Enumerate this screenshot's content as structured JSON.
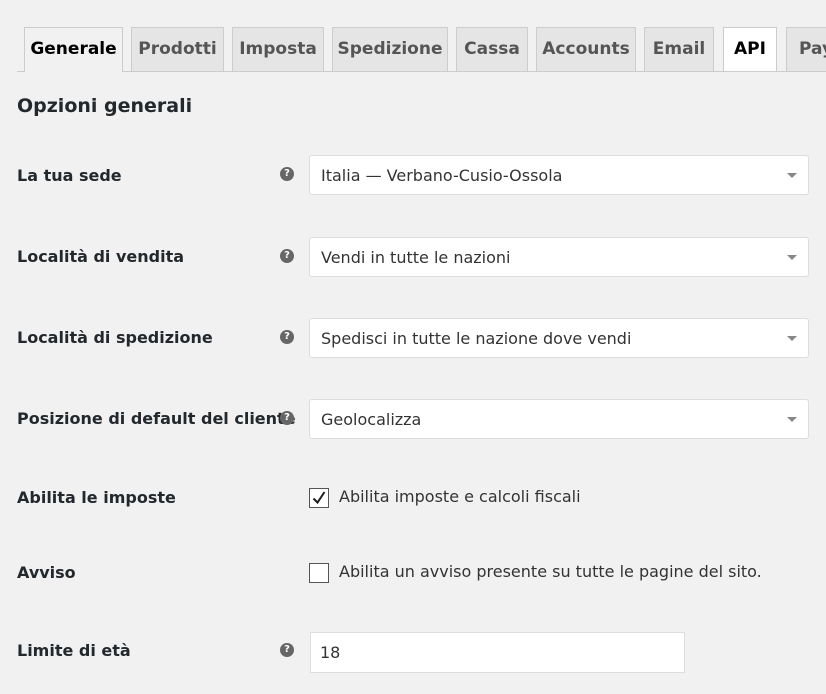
{
  "tabs": [
    {
      "label": "Generale",
      "state": "active"
    },
    {
      "label": "Prodotti",
      "state": "normal"
    },
    {
      "label": "Imposta",
      "state": "normal"
    },
    {
      "label": "Spedizione",
      "state": "normal"
    },
    {
      "label": "Cassa",
      "state": "normal"
    },
    {
      "label": "Accounts",
      "state": "normal"
    },
    {
      "label": "Email",
      "state": "normal"
    },
    {
      "label": "API",
      "state": "highlight"
    },
    {
      "label": "Pay",
      "state": "normal"
    }
  ],
  "section_title": "Opzioni generali",
  "help_icon": {
    "glyph": "?",
    "icon": "help-icon"
  },
  "fields": {
    "store_location": {
      "label": "La tua sede",
      "value": "Italia — Verbano-Cusio-Ossola"
    },
    "selling_location": {
      "label": "Località di vendita",
      "value": "Vendi in tutte le nazioni"
    },
    "shipping_location": {
      "label": "Località di spedizione",
      "value": "Spedisci in tutte le nazione dove vendi"
    },
    "default_customer_location": {
      "label": "Posizione di default del cliente",
      "value": "Geolocalizza"
    },
    "enable_taxes": {
      "label": "Abilita le imposte",
      "checkbox_label": "Abilita imposte e calcoli fiscali",
      "checked": true
    },
    "store_notice": {
      "label": "Avviso",
      "checkbox_label": "Abilita un avviso presente su tutte le pagine del sito.",
      "checked": false
    },
    "age_limit": {
      "label": "Limite di età",
      "value": "18"
    }
  },
  "colors": {
    "background": "#f1f1f1",
    "tab_inactive": "#e5e5e5",
    "tab_highlight": "#ffffff",
    "text": "#23282d",
    "help_icon": "#666666"
  }
}
